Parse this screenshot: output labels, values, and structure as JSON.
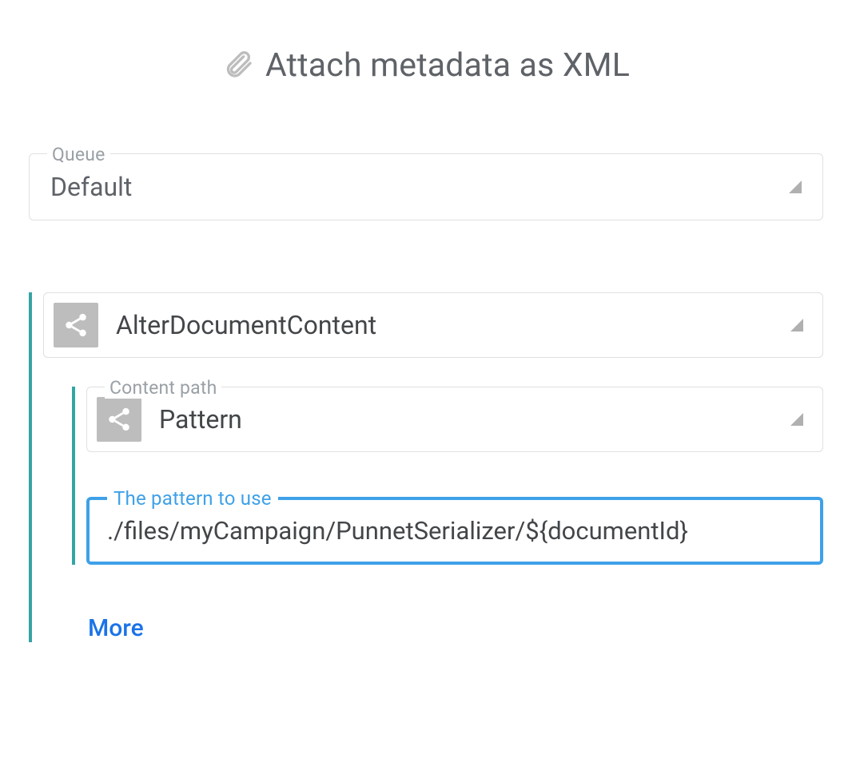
{
  "title": "Attach metadata as XML",
  "queue": {
    "label": "Queue",
    "value": "Default"
  },
  "task": {
    "value": "AlterDocumentContent",
    "content_path": {
      "label": "Content path",
      "value": "Pattern"
    },
    "pattern": {
      "label": "The pattern to use",
      "value": "./files/myCampaign/PunnetSerializer/${documentId}"
    },
    "more_label": "More"
  }
}
